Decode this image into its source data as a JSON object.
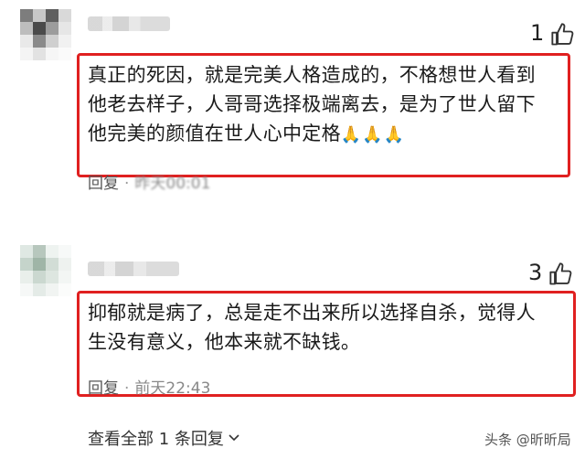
{
  "comments": [
    {
      "like_count": "1",
      "text_lines": [
        "真正的死因，就是完美人格造成的，不格想世人看到",
        "他老去样子，人哥哥选择极端离去，是为了世人留下",
        "他完美的颜值在世人心中定格"
      ],
      "emoji": "🙏🙏🙏",
      "reply_label": "回复",
      "time": "昨天00:01"
    },
    {
      "like_count": "3",
      "text_lines": [
        "抑郁就是病了，总是走不出来所以选择自杀，觉得人",
        "生没有意义，他本来就不缺钱。"
      ],
      "reply_label": "回复",
      "time": "前天22:43"
    }
  ],
  "footer": {
    "view_all": "查看全部 1 条回复",
    "chevron": "chevron-down-icon"
  },
  "watermark": "头条 @昕昕局",
  "colors": {
    "highlight_box": "#e02020"
  }
}
